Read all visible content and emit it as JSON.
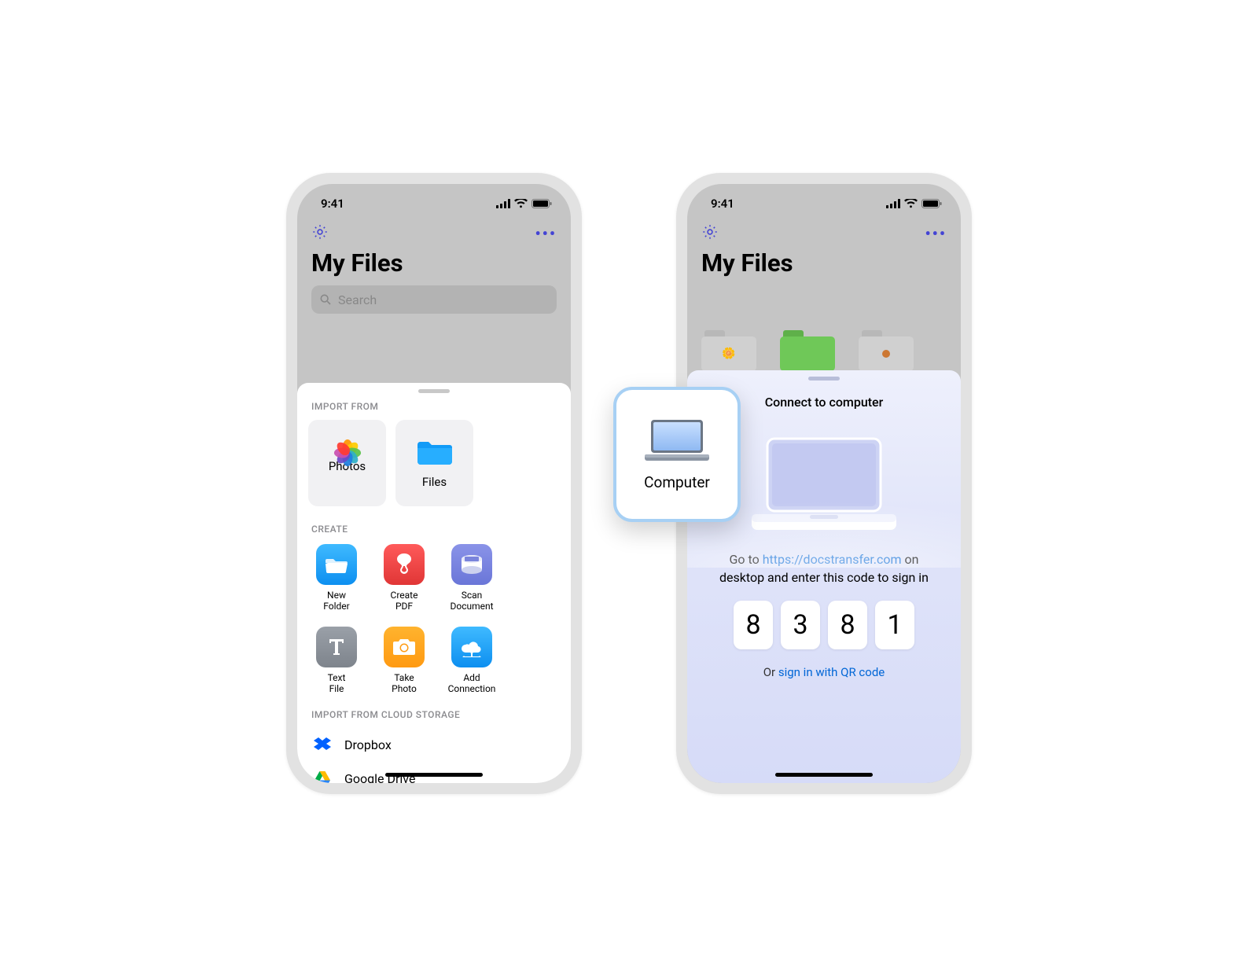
{
  "status": {
    "time": "9:41"
  },
  "header": {
    "title": "My Files",
    "search_placeholder": "Search"
  },
  "phoneA": {
    "import_section_label": "IMPORT FROM",
    "import_items": [
      {
        "label": "Photos"
      },
      {
        "label": "Files"
      },
      {
        "label": "Computer"
      }
    ],
    "create_section_label": "CREATE",
    "create_items": [
      {
        "label": "New\nFolder"
      },
      {
        "label": "Create\nPDF"
      },
      {
        "label": "Scan\nDocument"
      },
      {
        "label": "Text\nFile"
      },
      {
        "label": "Take\nPhoto"
      },
      {
        "label": "Add\nConnection"
      }
    ],
    "cloud_section_label": "IMPORT FROM CLOUD STORAGE",
    "cloud_items": [
      {
        "label": "Dropbox"
      },
      {
        "label": "Google Drive"
      }
    ]
  },
  "phoneB": {
    "sheet_title": "Connect to computer",
    "instruction_pre": "Go to ",
    "instruction_link": "https://docstransfer.com",
    "instruction_post": " on desktop and enter this code to sign in",
    "code": [
      "8",
      "3",
      "8",
      "1"
    ],
    "alt_pre": "Or ",
    "alt_link": "sign in with QR code"
  }
}
